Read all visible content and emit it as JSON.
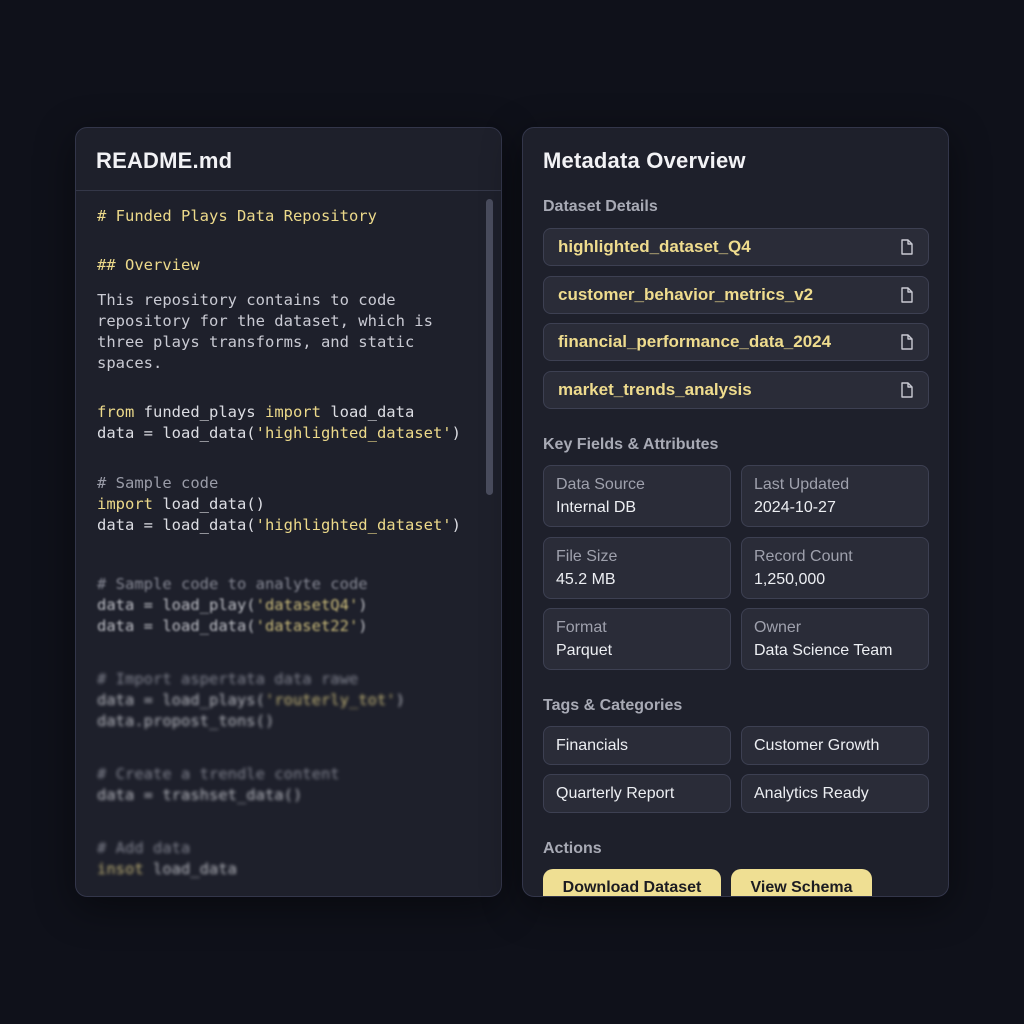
{
  "readme": {
    "title": "README.md",
    "lines": [
      "# Funded Plays Data Repository",
      "## Overview",
      "This repository contains to code",
      "repository for the dataset, which is",
      "three plays transforms, and static",
      "spaces.",
      "from",
      " funded_plays ",
      "import",
      " load_data",
      "data = load_data(",
      "'highlighted_dataset'",
      ")",
      "# Sample code",
      "import",
      " load_data()",
      "data = load_data(",
      "'highlighted_dataset'",
      ")",
      "# Sample code to analyte code",
      "data = load_play(",
      "'datasetQ4'",
      ")",
      "data = load_data(",
      "'dataset22'",
      ")",
      "# Import aspertata data rawe",
      "data = load_plays(",
      "'routerly_tot'",
      ")",
      "data.propost_tons()",
      "# Create a trendle content",
      "data = trashset_data()",
      "# Add data",
      "insot",
      " load_data"
    ]
  },
  "metadata": {
    "title": "Metadata Overview",
    "dataset_details_label": "Dataset Details",
    "datasets": [
      {
        "name": "highlighted_dataset_Q4",
        "icon": "file-icon"
      },
      {
        "name": "customer_behavior_metrics_v2",
        "icon": "file-icon"
      },
      {
        "name": "financial_performance_data_2024",
        "icon": "file-icon"
      },
      {
        "name": "market_trends_analysis",
        "icon": "file-icon"
      }
    ],
    "key_fields_label": "Key Fields & Attributes",
    "fields": [
      {
        "label": "Data Source",
        "value": "Internal DB"
      },
      {
        "label": "Last Updated",
        "value": "2024-10-27"
      },
      {
        "label": "File Size",
        "value": "45.2 MB"
      },
      {
        "label": "Record Count",
        "value": "1,250,000"
      },
      {
        "label": "Format",
        "value": "Parquet"
      },
      {
        "label": "Owner",
        "value": "Data Science Team"
      }
    ],
    "tags_label": "Tags & Categories",
    "tags": [
      "Financials",
      "Customer Growth",
      "Quarterly Report",
      "Analytics Ready"
    ],
    "actions_label": "Actions",
    "actions": [
      "Download Dataset",
      "View Schema"
    ]
  },
  "colors": {
    "accent": "#efdf93",
    "background": "#0f111a",
    "panel": "#1e202b"
  }
}
